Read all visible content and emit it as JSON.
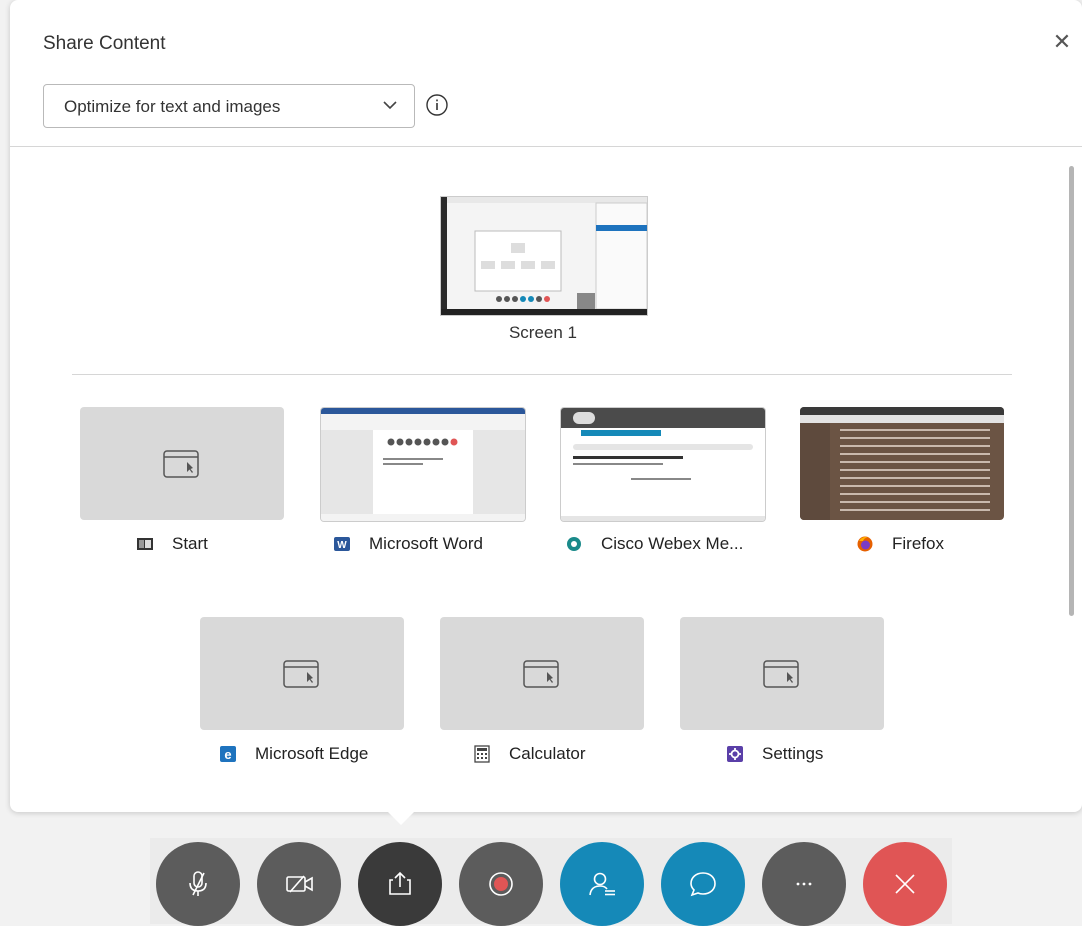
{
  "dialog": {
    "title": "Share Content",
    "close_icon": "close-icon",
    "optimize_select": {
      "value": "Optimize for text and images"
    },
    "info_icon": "info-icon"
  },
  "screens": [
    {
      "label": "Screen 1"
    }
  ],
  "windows": [
    {
      "label": "Start",
      "icon": "start-app-icon"
    },
    {
      "label": "Microsoft Word",
      "icon": "word-app-icon"
    },
    {
      "label": "Cisco Webex Me...",
      "icon": "webex-app-icon"
    },
    {
      "label": "Firefox",
      "icon": "firefox-app-icon"
    },
    {
      "label": "Microsoft Edge",
      "icon": "edge-app-icon"
    },
    {
      "label": "Calculator",
      "icon": "calculator-app-icon"
    },
    {
      "label": "Settings",
      "icon": "settings-app-icon"
    }
  ],
  "toolbar": {
    "buttons": [
      {
        "name": "mute",
        "icon": "microphone-muted-icon",
        "color": "#5c5c5c"
      },
      {
        "name": "video",
        "icon": "video-off-icon",
        "color": "#5c5c5c"
      },
      {
        "name": "share",
        "icon": "share-icon",
        "color": "#3a3a3a"
      },
      {
        "name": "record",
        "icon": "record-icon",
        "color": "#5c5c5c"
      },
      {
        "name": "participants",
        "icon": "participants-icon",
        "color": "#1589b8"
      },
      {
        "name": "chat",
        "icon": "chat-icon",
        "color": "#1589b8"
      },
      {
        "name": "more",
        "icon": "more-icon",
        "color": "#5c5c5c"
      },
      {
        "name": "leave",
        "icon": "close-icon",
        "color": "#e05555"
      }
    ]
  },
  "colors": {
    "accent": "#1589b8",
    "danger": "#e05555",
    "thumb_bg": "#d9d9d9"
  }
}
